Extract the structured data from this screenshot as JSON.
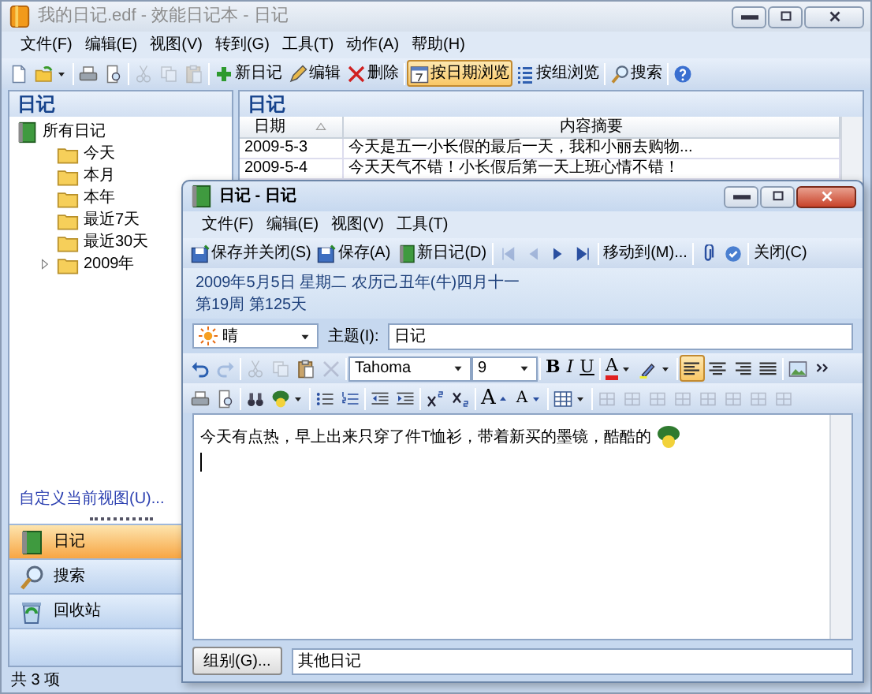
{
  "window": {
    "title": "我的日记.edf - 效能日记本 - 日记"
  },
  "menu": [
    "文件(F)",
    "编辑(E)",
    "视图(V)",
    "转到(G)",
    "工具(T)",
    "动作(A)",
    "帮助(H)"
  ],
  "toolbar": [
    {
      "disabled": false
    },
    {
      "disabled": false
    },
    {
      "disabled": false
    },
    {
      "disabled": false
    },
    {
      "disabled": true
    },
    {
      "disabled": true
    },
    {
      "disabled": true
    },
    {
      "label": "新日记",
      "disabled": false
    },
    {
      "label": "编辑",
      "disabled": false
    },
    {
      "label": "删除",
      "disabled": false
    },
    {
      "label": "按日期浏览",
      "disabled": false,
      "selected": true
    },
    {
      "label": "按组浏览",
      "disabled": false,
      "selected": false
    },
    {
      "label": "搜索",
      "disabled": false
    },
    {
      "disabled": false
    }
  ],
  "navigation": {
    "title": "日记",
    "tree": [
      {
        "label": "所有日记",
        "children": [
          {
            "label": "今天"
          },
          {
            "label": "本月"
          },
          {
            "label": "本年"
          },
          {
            "label": "最近7天"
          },
          {
            "label": "最近30天"
          },
          {
            "label": "2009年",
            "expanded": false
          }
        ]
      }
    ],
    "customize_link": "自定义当前视图(U)...",
    "sections": [
      {
        "label": "日记",
        "selected": true
      },
      {
        "label": "搜索",
        "selected": false
      },
      {
        "label": "回收站",
        "selected": false
      }
    ]
  },
  "list": {
    "title": "日记",
    "columns": [
      {
        "label": "日期",
        "sorted": true
      },
      {
        "label": "内容摘要"
      }
    ],
    "rows": [
      [
        "2009-5-3",
        "今天是五一小长假的最后一天，我和小丽去购物..."
      ],
      [
        "2009-5-4",
        "今天天气不错！小长假后第一天上班心情不错！"
      ]
    ]
  },
  "status_bar": "共 3 项",
  "entry_window": {
    "title": "日记 - 日记",
    "menu": [
      "文件(F)",
      "编辑(E)",
      "视图(V)",
      "工具(T)"
    ],
    "toolbar": [
      {
        "label": "保存并关闭(S)",
        "disabled": false
      },
      {
        "label": "保存(A)",
        "disabled": false
      },
      {
        "label": "新日记(D)",
        "disabled": false
      },
      {
        "disabled": true
      },
      {
        "disabled": true
      },
      {
        "disabled": false
      },
      {
        "disabled": false
      },
      {
        "label": "移动到(M)...",
        "disabled": false
      },
      {
        "disabled": false
      },
      {
        "disabled": false
      },
      {
        "label": "关闭(C)",
        "disabled": false
      }
    ],
    "date_line": "2009年5月5日 星期二 农历己丑年(牛)四月十一",
    "week_line": "第19周 第125天",
    "weather": {
      "value": "晴"
    },
    "subject": {
      "label": "主题(I):",
      "value": "日记"
    },
    "format_toolbar": [
      {
        "kind": "button",
        "disabled": false
      },
      {
        "kind": "button",
        "disabled": true
      },
      {
        "kind": "button",
        "disabled": true
      },
      {
        "kind": "button",
        "disabled": true
      },
      {
        "kind": "button",
        "disabled": false
      },
      {
        "kind": "button",
        "disabled": true
      },
      {
        "kind": "combo",
        "value": "Tahoma"
      },
      {
        "kind": "combo",
        "value": "9"
      },
      {
        "kind": "button",
        "label": "B",
        "disabled": false
      },
      {
        "kind": "button",
        "label": "I",
        "disabled": false
      },
      {
        "kind": "button",
        "label": "U",
        "disabled": false
      },
      {
        "kind": "button",
        "label": "A",
        "disabled": false
      },
      {
        "kind": "button",
        "disabled": false
      },
      {
        "kind": "button",
        "disabled": false,
        "selected": true
      },
      {
        "kind": "button",
        "disabled": false,
        "selected": false
      },
      {
        "kind": "button",
        "disabled": false,
        "selected": false
      },
      {
        "kind": "button",
        "disabled": false,
        "selected": false
      },
      {
        "kind": "button",
        "disabled": false
      },
      {
        "kind": "button",
        "disabled": false
      }
    ],
    "format_toolbar_2": [
      {
        "disabled": false
      },
      {
        "disabled": false
      },
      {
        "disabled": false
      },
      {
        "disabled": false
      },
      {
        "disabled": false
      },
      {
        "disabled": false
      },
      {
        "disabled": false
      },
      {
        "disabled": false
      },
      {
        "disabled": false
      },
      {
        "disabled": false
      },
      {
        "label": "A",
        "disabled": false
      },
      {
        "label": "A",
        "disabled": false
      },
      {
        "disabled": false
      },
      {
        "disabled": true
      },
      {
        "disabled": true
      },
      {
        "disabled": true
      },
      {
        "disabled": true
      },
      {
        "disabled": true
      },
      {
        "disabled": true
      },
      {
        "disabled": true
      },
      {
        "disabled": true
      }
    ],
    "body": "今天有点热，早上出来只穿了件T恤衫，带着新买的墨镜，酷酷的",
    "group_button": "组别(G)...",
    "group_value": "其他日记"
  }
}
